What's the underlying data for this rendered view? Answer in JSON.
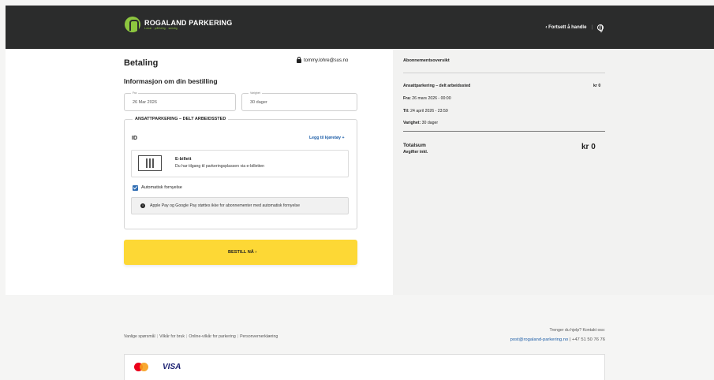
{
  "header": {
    "logo_text": "ROGALAND PARKERING",
    "logo_sub": "Lokal · pålitelig · smidig",
    "continue_label": "‹ Fortsett å handle",
    "separator": "|",
    "language_icon": "globe-icon"
  },
  "payment": {
    "title": "Betaling",
    "email": "tommy.lohre@sus.no",
    "subtitle": "Informasjon om din bestilling",
    "from_label": "Fra",
    "from_value": "26 Mar 2026",
    "duration_label": "Varighet",
    "duration_value": "30 dager"
  },
  "product": {
    "title": "ANSATTPARKERING – DELT ARBEIDSSTED",
    "id_label": "ID",
    "add_vehicle": "Legg til kjøretøy +",
    "ticket_title": "E-billett",
    "ticket_desc": "Du har tilgang til parkeringsplassen via e-billetten",
    "auto_renew_label": "Automatisk fornyelse",
    "auto_renew_checked": true,
    "info_text": "Apple Pay og Google Pay støttes ikke for abonnementer med automatisk fornyelse"
  },
  "order_button": "BESTILL NÅ  ›",
  "overview": {
    "title": "Abonnementsoversikt",
    "product_name": "Ansattparkering – delt arbeidssted",
    "product_price": "kr 0",
    "from_key": "Fra:",
    "from_value": "26 mars 2026 - 00:00",
    "to_key": "Til:",
    "to_value": "24 april 2026 - 23:59",
    "duration_key": "Varighet:",
    "duration_value": "30 dager",
    "total_label": "Totalsum",
    "fees_label": "Avgifter inkl.",
    "total_price": "kr 0"
  },
  "footer": {
    "links": [
      "Vanlige spørsmål",
      "Vilkår for bruk",
      "Online-vilkår for parkering",
      "Personvernerklæring"
    ],
    "help_text": "Trenger du hjelp? Kontakt oss:",
    "contact_email": "post@rogaland-parkering.no",
    "contact_phone": " | +47 51 50 76 76",
    "payment_visa": "VISA"
  },
  "colors": {
    "topbar": "#2b2c2c",
    "accent_yellow": "#fdd835",
    "link_blue": "#1f5fa8",
    "logo_green": "#8dc63f"
  }
}
